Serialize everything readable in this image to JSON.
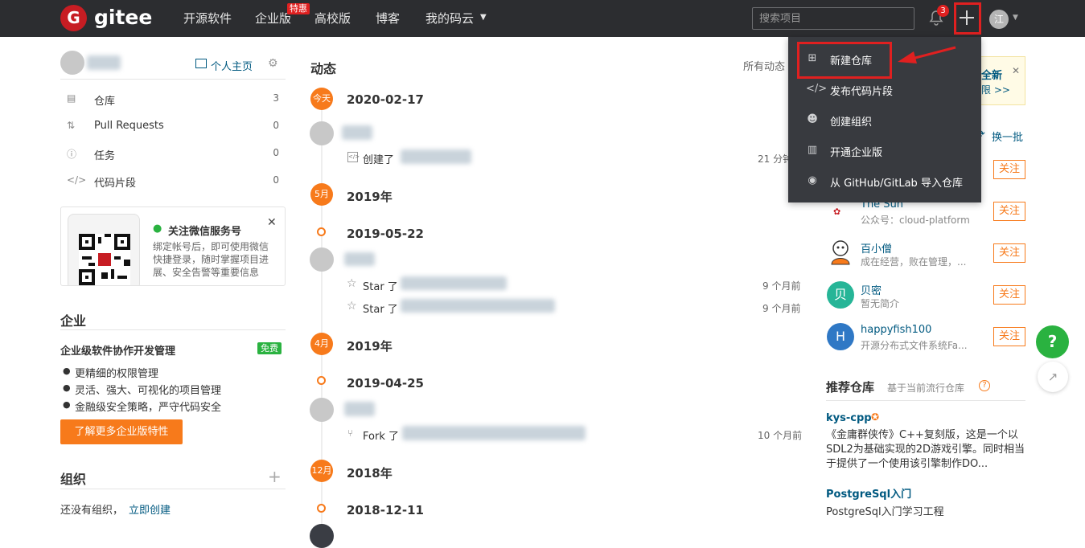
{
  "topbar": {
    "logo_letter": "G",
    "logo_text": "gitee",
    "nav": [
      "开源软件",
      "企业版",
      "高校版",
      "博客",
      "我的码云"
    ],
    "nav_badge": "特惠",
    "search_placeholder": "搜索项目",
    "notification_count": "3",
    "avatar_letter": "江"
  },
  "dropdown": {
    "items": [
      "新建仓库",
      "发布代码片段",
      "创建组织",
      "开通企业版",
      "从 GitHub/GitLab 导入仓库"
    ]
  },
  "sidebar": {
    "homepage_link": "个人主页",
    "menu": [
      {
        "label": "仓库",
        "count": "3",
        "icon": "repo-icon"
      },
      {
        "label": "Pull Requests",
        "count": "0",
        "icon": "pr-icon"
      },
      {
        "label": "任务",
        "count": "0",
        "icon": "issue-icon"
      },
      {
        "label": "代码片段",
        "count": "0",
        "icon": "code-icon"
      }
    ],
    "wechat": {
      "title": "关注微信服务号",
      "desc": "绑定帐号后，即可使用微信快捷登录，随时掌握项目进展、安全告警等重要信息"
    },
    "enterprise": {
      "title": "企业",
      "subtitle": "企业级软件协作开发管理",
      "badge": "免费",
      "bullets": [
        "更精细的权限管理",
        "灵活、强大、可视化的项目管理",
        "金融级安全策略，严守代码安全"
      ],
      "button": "了解更多企业版特性"
    },
    "org": {
      "title": "组织",
      "empty_text": "还没有组织，",
      "create_link": "立即创建"
    }
  },
  "feed": {
    "title": "动态",
    "filter": "所有动态",
    "entries": {
      "today_badge": "今天",
      "d1": "2020-02-17",
      "a1": "创建了",
      "t1": "21 分钟",
      "m1_badge": "5月",
      "y1": "2019年",
      "d2": "2019-05-22",
      "a2": "Star 了",
      "t2": "9 个月前",
      "a3": "Star 了",
      "t3": "9 个月前",
      "m2_badge": "4月",
      "y2": "2019年",
      "d3": "2019-04-25",
      "a4": "Fork 了",
      "t4": "10 个月前",
      "m3_badge": "12月",
      "y3": "2018年",
      "d4": "2018-12-11"
    }
  },
  "right": {
    "banner_line1": "全新",
    "banner_line2": "限 >>",
    "refresh": "换一批",
    "follow_label": "关注",
    "users": [
      {
        "name": "The Sun",
        "desc": "公众号：cloud-platform"
      },
      {
        "name": "百小僧",
        "desc": "成在经营，败在管理，..."
      },
      {
        "name": "贝密",
        "desc": "暂无简介",
        "letter": "贝",
        "color": "#26b597"
      },
      {
        "name": "happyfish100",
        "desc": "开源分布式文件系统Fa...",
        "letter": "H",
        "color": "#2f78c5"
      }
    ],
    "recommend": {
      "title": "推荐仓库",
      "subtitle": "基于当前流行仓库",
      "repos": [
        {
          "name": "kys-cpp",
          "desc": "《金庸群侠传》C++复刻版，这是一个以SDL2为基础实现的2D游戏引擎。同时相当于提供了一个使用该引擎制作DO..."
        },
        {
          "name": "PostgreSql入门",
          "desc": "PostgreSql入门学习工程"
        }
      ]
    },
    "help_button": "?"
  },
  "colors": {
    "accent": "#f77a1b",
    "topbar": "#2c2d30",
    "dropdown": "#383a3f",
    "highlight": "#e02020",
    "link": "#005980"
  }
}
